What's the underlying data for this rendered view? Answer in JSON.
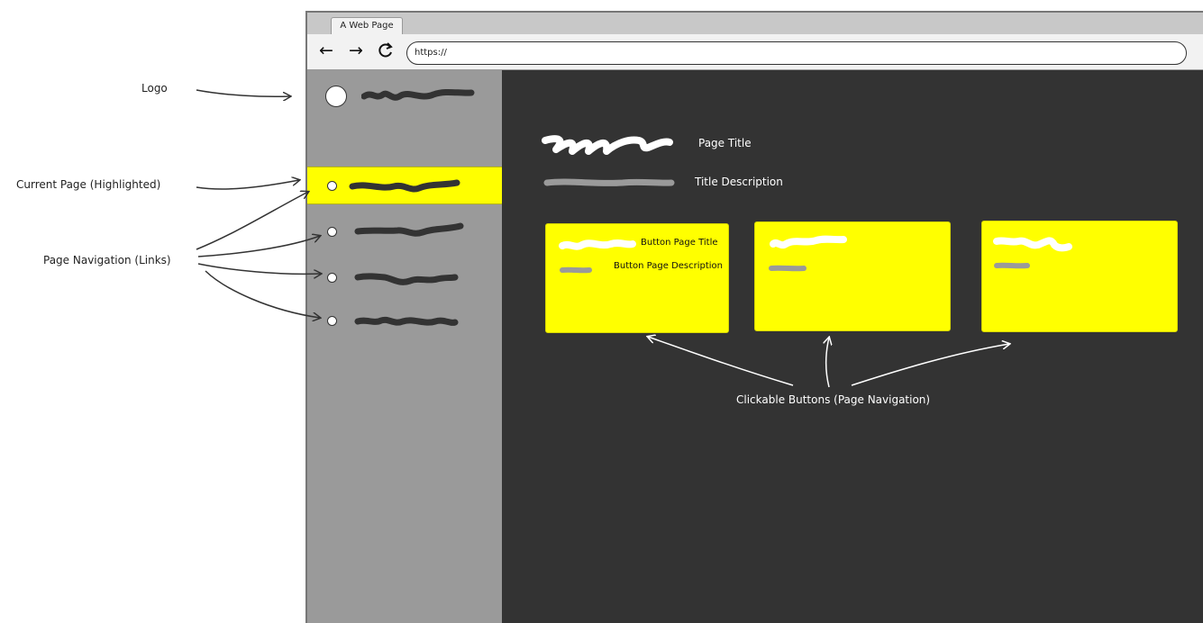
{
  "browser": {
    "tab_title": "A Web Page",
    "url": "https://",
    "back_icon": "back-arrow-icon",
    "forward_icon": "forward-arrow-icon",
    "reload_icon": "reload-icon"
  },
  "annotations": {
    "logo": "Logo",
    "current_page": "Current Page (Highlighted)",
    "page_navigation": "Page Navigation (Links)",
    "clickable_buttons": "Clickable Buttons (Page Navigation)"
  },
  "main": {
    "page_title_label": "Page Title",
    "title_description_label": "Title Description"
  },
  "cards": [
    {
      "title_label": "Button Page Title",
      "description_label": "Button Page Description"
    },
    {
      "title_label": "",
      "description_label": ""
    },
    {
      "title_label": "",
      "description_label": ""
    }
  ],
  "colors": {
    "highlight": "#ffff00",
    "sidebar": "#9a9a9a",
    "content_bg": "#333333",
    "scribble_dark": "#333333",
    "scribble_light": "#ffffff",
    "scribble_gray": "#9a9a9a"
  }
}
